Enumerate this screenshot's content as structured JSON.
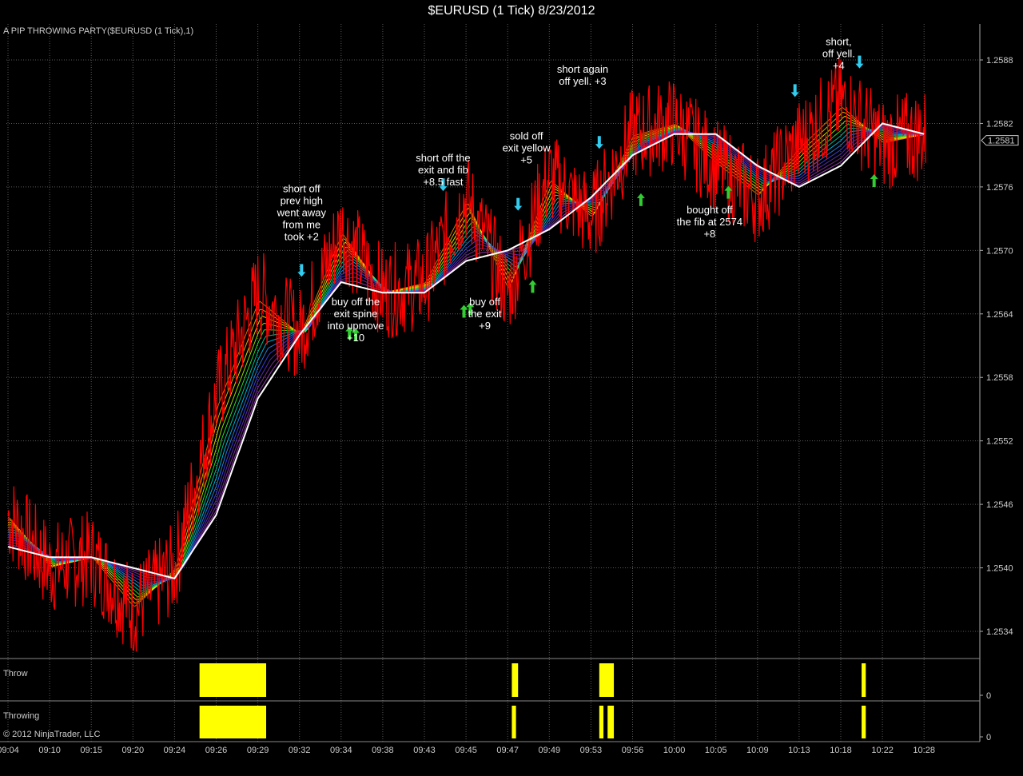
{
  "window": {
    "title": "$EURUSD (1 Tick)  8/23/2012"
  },
  "indicator_label": "A PIP THROWING PARTY($EURUSD (1 Tick),1)",
  "copyright": "© 2012 NinjaTrader, LLC",
  "colors": {
    "background": "#000000",
    "grid": "#5a5a5a",
    "price": "#ff0000",
    "spine": "#ffffff",
    "throw_bar": "#ffff00",
    "short_arrow": "#33ccee",
    "buy_arrow": "#33cc33"
  },
  "chart_data": [
    {
      "type": "line",
      "title": "$EURUSD (1 Tick)  8/23/2012",
      "grid": true,
      "y_axis_side": "right",
      "x_tick_labels": [
        "09:04",
        "09:10",
        "09:15",
        "09:20",
        "09:24",
        "09:26",
        "09:29",
        "09:32",
        "09:34",
        "09:38",
        "09:43",
        "09:45",
        "09:47",
        "09:49",
        "09:53",
        "09:56",
        "10:00",
        "10:05",
        "10:09",
        "10:13",
        "10:18",
        "10:22",
        "10:28"
      ],
      "y_tick_labels": [
        "1.2588",
        "1.2582",
        "1.2576",
        "1.2570",
        "1.2564",
        "1.2558",
        "1.2552",
        "1.2546",
        "1.2540",
        "1.2534"
      ],
      "ylim": [
        1.253,
        1.259
      ],
      "last_price": "1.2581",
      "series": [
        {
          "name": "$EURUSD",
          "x": [
            0,
            1,
            2,
            3,
            4,
            5,
            6,
            7,
            8,
            9,
            10,
            11,
            12,
            13,
            14,
            15,
            16,
            17,
            18,
            19,
            20,
            21,
            22
          ],
          "values": [
            1.2545,
            1.254,
            1.2541,
            1.2536,
            1.254,
            1.2556,
            1.2566,
            1.2562,
            1.2572,
            1.2566,
            1.2567,
            1.2575,
            1.2566,
            1.2577,
            1.2573,
            1.2581,
            1.2582,
            1.2578,
            1.2575,
            1.258,
            1.2584,
            1.258,
            1.2581
          ]
        },
        {
          "name": "spine",
          "x": [
            0,
            1,
            2,
            3,
            4,
            5,
            6,
            7,
            8,
            9,
            10,
            11,
            12,
            13,
            14,
            15,
            16,
            17,
            18,
            19,
            20,
            21,
            22
          ],
          "values": [
            1.2542,
            1.2541,
            1.2541,
            1.254,
            1.2539,
            1.2545,
            1.2556,
            1.2562,
            1.2567,
            1.2566,
            1.2566,
            1.2569,
            1.257,
            1.2572,
            1.2575,
            1.2579,
            1.2581,
            1.2581,
            1.2578,
            1.2576,
            1.2578,
            1.2582,
            1.2581
          ]
        }
      ],
      "annotations": [
        {
          "text": [
            "short off",
            "prev high",
            "went away",
            "from me",
            "took +2"
          ],
          "x": 7.05,
          "y": 1.25755
        },
        {
          "text": [
            "buy off the",
            "exit spine",
            "into upmove",
            "+10"
          ],
          "x": 8.35,
          "y": 1.25648
        },
        {
          "text": [
            "short off the",
            "exit and fib",
            "+8.5 fast"
          ],
          "x": 10.45,
          "y": 1.25784
        },
        {
          "text": [
            "buy off",
            "the exit",
            "+9"
          ],
          "x": 11.45,
          "y": 1.25648
        },
        {
          "text": [
            "sold off",
            "exit yellow",
            "+5"
          ],
          "x": 12.45,
          "y": 1.25805
        },
        {
          "text": [
            "short again",
            "off yell. +3"
          ],
          "x": 13.8,
          "y": 1.25868
        },
        {
          "text": [
            "bought off",
            "the fib at 2574",
            "+8"
          ],
          "x": 16.85,
          "y": 1.25735
        },
        {
          "text": [
            "short,",
            "off yell.",
            "+4"
          ],
          "x": 19.95,
          "y": 1.25894
        }
      ],
      "short_arrows_x": [
        7.05,
        10.45,
        12.25,
        14.2,
        18.9,
        20.45
      ],
      "buy_arrows_x": [
        8.2,
        8.35,
        10.95,
        11.1,
        12.6,
        15.2,
        17.3,
        20.8
      ]
    },
    {
      "type": "bar",
      "title": "Throw",
      "y_tick_labels": [
        "0"
      ],
      "bars": [
        {
          "x0": 4.6,
          "x1": 6.2
        },
        {
          "x0": 12.1,
          "x1": 12.25
        },
        {
          "x0": 14.2,
          "x1": 14.55
        },
        {
          "x0": 20.5,
          "x1": 20.6
        }
      ]
    },
    {
      "type": "bar",
      "title": "Throwing",
      "y_tick_labels": [
        "0"
      ],
      "bars": [
        {
          "x0": 4.6,
          "x1": 6.2
        },
        {
          "x0": 12.1,
          "x1": 12.2
        },
        {
          "x0": 14.2,
          "x1": 14.3
        },
        {
          "x0": 14.4,
          "x1": 14.55
        },
        {
          "x0": 20.5,
          "x1": 20.6
        }
      ]
    }
  ]
}
